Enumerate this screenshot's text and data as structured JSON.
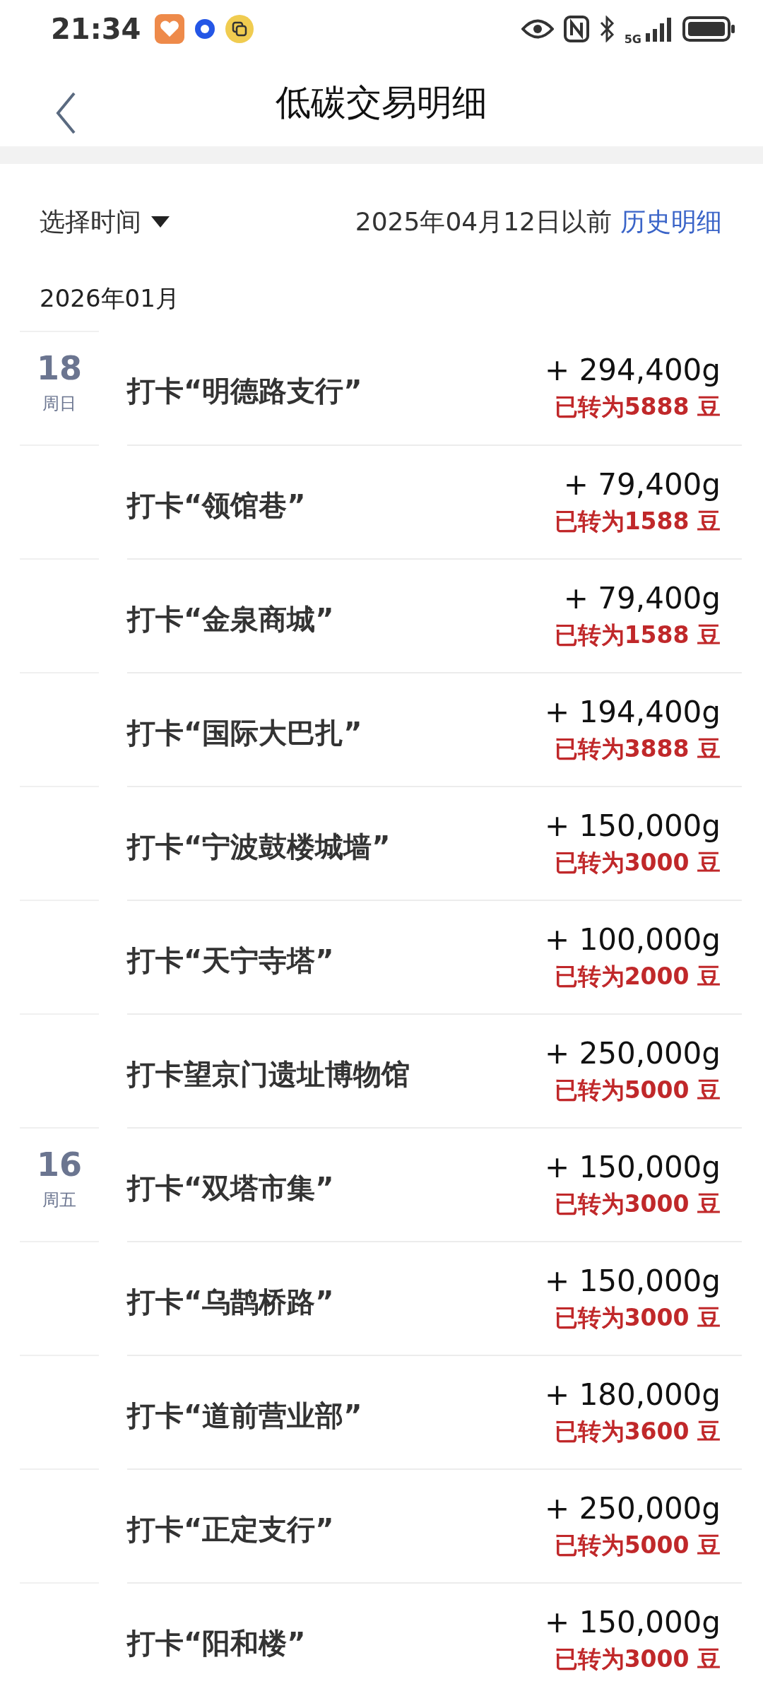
{
  "status_bar": {
    "time": "21:34",
    "network": "5G"
  },
  "header": {
    "title": "低碳交易明细"
  },
  "filter": {
    "label": "选择时间",
    "note": "2025年04月12日以前",
    "link": "历史明细"
  },
  "month": "2026年01月",
  "groups": [
    {
      "day": "18",
      "weekday": "周日",
      "items": [
        {
          "title": "打卡“明德路支行”",
          "amount": "+ 294,400g",
          "converted": "已转为5888 豆"
        },
        {
          "title": "打卡“领馆巷”",
          "amount": "+ 79,400g",
          "converted": "已转为1588 豆"
        },
        {
          "title": "打卡“金泉商城”",
          "amount": "+ 79,400g",
          "converted": "已转为1588 豆"
        },
        {
          "title": "打卡“国际大巴扎”",
          "amount": "+ 194,400g",
          "converted": "已转为3888 豆"
        },
        {
          "title": "打卡“宁波鼓楼城墙”",
          "amount": "+ 150,000g",
          "converted": "已转为3000 豆"
        },
        {
          "title": "打卡“天宁寺塔”",
          "amount": "+ 100,000g",
          "converted": "已转为2000 豆"
        },
        {
          "title": "打卡望京门遗址博物馆",
          "amount": "+ 250,000g",
          "converted": "已转为5000 豆"
        }
      ]
    },
    {
      "day": "16",
      "weekday": "周五",
      "items": [
        {
          "title": "打卡“双塔市集”",
          "amount": "+ 150,000g",
          "converted": "已转为3000 豆"
        },
        {
          "title": "打卡“乌鹊桥路”",
          "amount": "+ 150,000g",
          "converted": "已转为3000 豆"
        },
        {
          "title": "打卡“道前营业部”",
          "amount": "+ 180,000g",
          "converted": "已转为3600 豆"
        },
        {
          "title": "打卡“正定支行”",
          "amount": "+ 250,000g",
          "converted": "已转为5000 豆"
        },
        {
          "title": "打卡“阳和楼”",
          "amount": "+ 150,000g",
          "converted": "已转为3000 豆"
        }
      ]
    }
  ]
}
